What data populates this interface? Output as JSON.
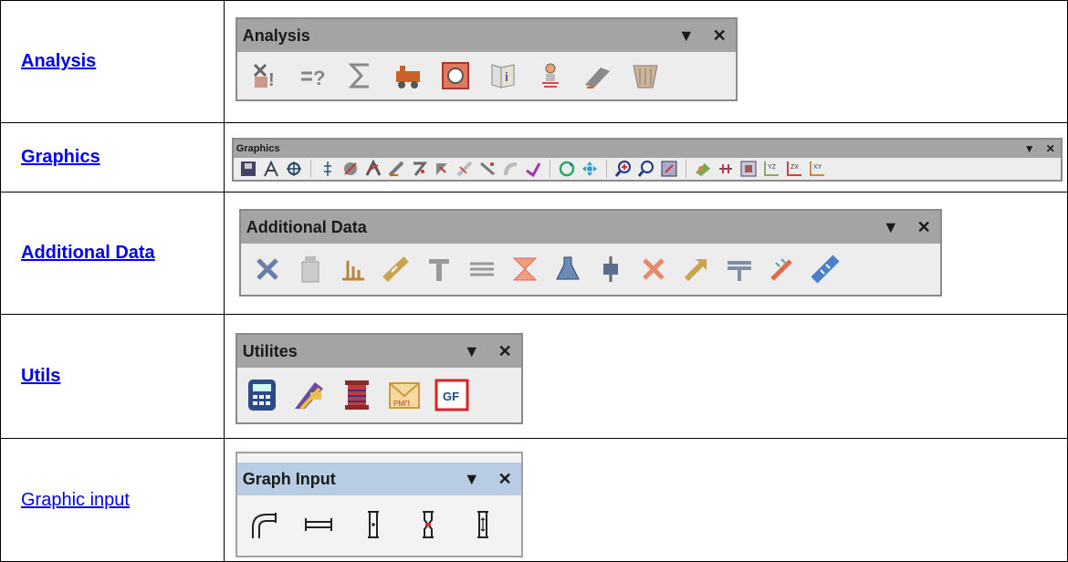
{
  "rows": [
    {
      "label": "Analysis",
      "toolbar_title": "Analysis"
    },
    {
      "label": "Graphics",
      "toolbar_title": "Graphics"
    },
    {
      "label": "Additional Data",
      "toolbar_title": "Additional Data"
    },
    {
      "label": "Utils",
      "toolbar_title": "Utilites"
    },
    {
      "label": "Graphic input",
      "toolbar_title": "Graph Input"
    }
  ],
  "controls": {
    "dropdown": "▼",
    "close": "✕"
  },
  "utils_gf_text": "GF",
  "utils_pmp_text": "PMП"
}
